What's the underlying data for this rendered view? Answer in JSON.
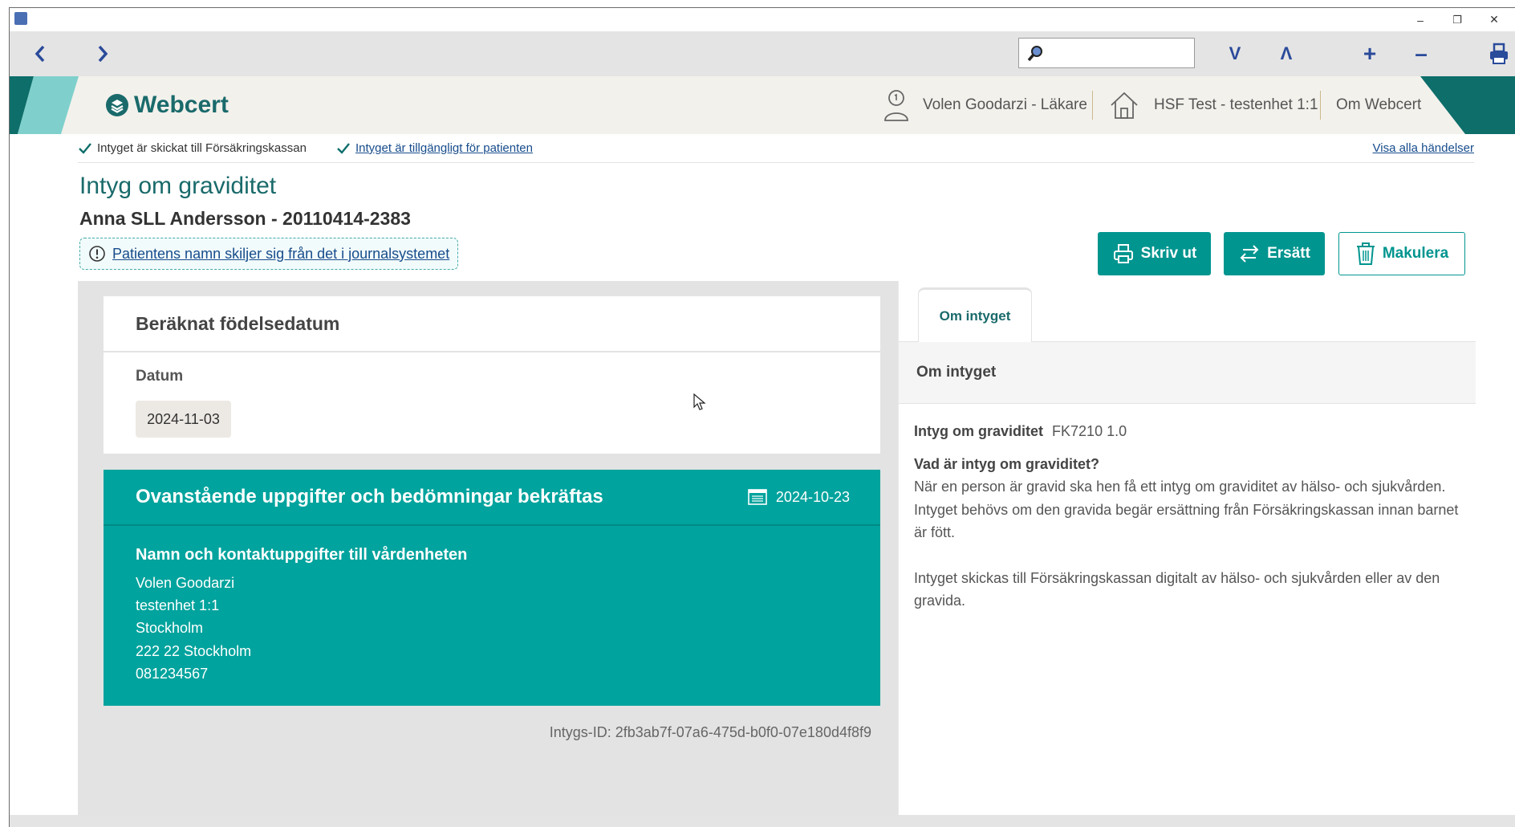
{
  "window": {
    "minimize": "–",
    "restore": "❐",
    "close": "✕"
  },
  "toolbar": {
    "back_icon": "chevron-left-icon",
    "forward_icon": "chevron-right-icon",
    "search_placeholder": "",
    "find_next": "V",
    "find_prev": "Λ",
    "zoom_in": "+",
    "zoom_out": "–",
    "print_icon": "printer-icon"
  },
  "header": {
    "brand": "Webcert",
    "user": "Volen Goodarzi - Läkare",
    "unit": "HSF Test - testenhet 1:1",
    "about": "Om Webcert",
    "colors": {
      "teal_dark": "#0d6e6a",
      "teal_light": "#7fd0cc",
      "beige": "#f3f1ec"
    }
  },
  "status": {
    "sent": "Intyget är skickat till Försäkringskassan",
    "available": "Intyget är tillgängligt för patienten",
    "show_all": "Visa alla händelser"
  },
  "certificate": {
    "title": "Intyg om graviditet",
    "patient": "Anna SLL Andersson - 20110414-2383",
    "name_warning": "Patientens namn skiljer sig från det i journalsystemet",
    "buttons": {
      "print": "Skriv ut",
      "replace": "Ersätt",
      "revoke": "Makulera"
    },
    "due_date_section": {
      "title": "Beräknat födelsedatum",
      "date_label": "Datum",
      "date_value": "2024-11-03"
    },
    "confirmation": {
      "title": "Ovanstående uppgifter och bedömningar bekräftas",
      "date": "2024-10-23",
      "contact_title": "Namn och kontaktuppgifter till vårdenheten",
      "contact_lines": [
        "Volen Goodarzi",
        "testenhet 1:1",
        "Stockholm",
        "222 22 Stockholm",
        "081234567"
      ]
    },
    "id_line": "Intygs-ID: 2fb3ab7f-07a6-475d-b0f0-07e180d4f8f9",
    "accent_color": "#00a39d"
  },
  "panel": {
    "tab": "Om intyget",
    "subhead": "Om intyget",
    "cert_name": "Intyg om graviditet",
    "cert_code": "FK7210 1.0",
    "question": "Vad är intyg om graviditet?",
    "paragraph1": "När en person är gravid ska hen få ett intyg om graviditet av hälso- och sjukvården. Intyget behövs om den gravida begär ersättning från Försäkringskassan innan barnet är fött.",
    "paragraph2": "Intyget skickas till Försäkringskassan digitalt av hälso- och sjukvården eller av den gravida."
  }
}
